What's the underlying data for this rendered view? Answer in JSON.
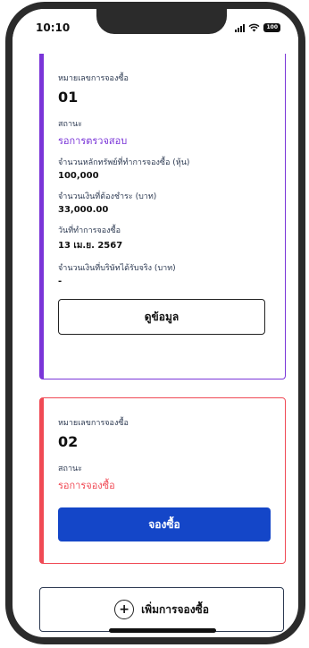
{
  "status_bar": {
    "time": "10:10",
    "battery": "100"
  },
  "orders": [
    {
      "order_label": "หมายเลขการจองซื้อ",
      "order_no": "01",
      "status_label": "สถานะ",
      "status": "รอการตรวจสอบ",
      "shares_label": "จำนวนหลักทรัพย์ที่ทำการจองซื้อ (หุ้น)",
      "shares": "100,000",
      "amount_label": "จำนวนเงินที่ต้องชำระ (บาท)",
      "amount": "33,000.00",
      "date_label": "วันที่ทำการจองซื้อ",
      "date": "13 เม.ย. 2567",
      "received_label": "จำนวนเงินที่บริษัทได้รับจริง (บาท)",
      "received": "-",
      "button_label": "ดูข้อมูล"
    },
    {
      "order_label": "หมายเลขการจองซื้อ",
      "order_no": "02",
      "status_label": "สถานะ",
      "status": "รอการจองซื้อ",
      "button_label": "จองซื้อ"
    }
  ],
  "add_button_label": "เพิ่มการจองซื้อ",
  "colors": {
    "purple": "#7a35d8",
    "red": "#f04a55",
    "primary": "#1446c8"
  },
  "icons": {
    "add": "plus-circle-icon",
    "signal": "signal-icon",
    "wifi": "wifi-icon",
    "battery": "battery-icon"
  }
}
